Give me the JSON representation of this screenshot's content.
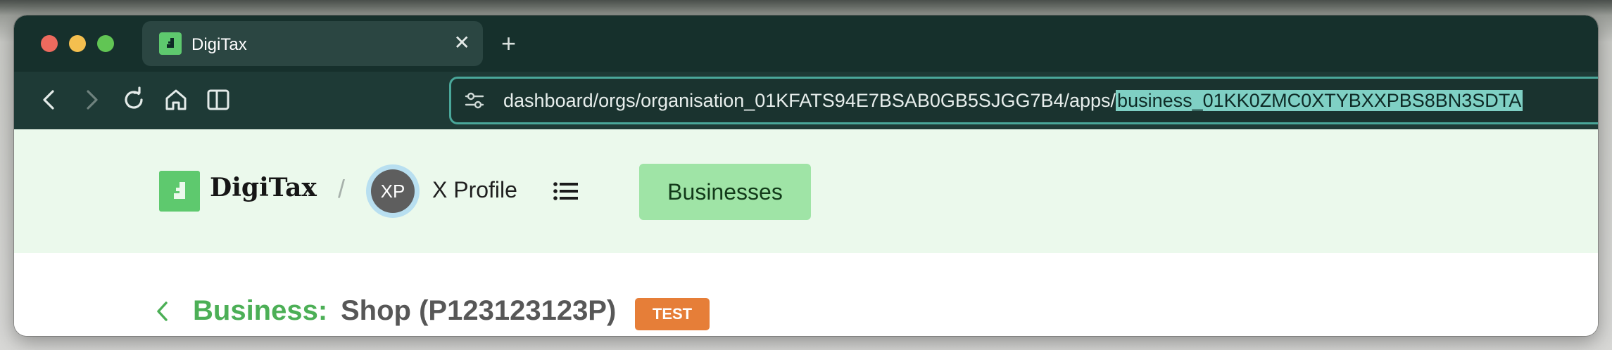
{
  "browser": {
    "tab": {
      "title": "DigiTax",
      "close_glyph": "✕"
    },
    "new_tab_glyph": "+",
    "toolbar_icons": [
      "back-arrow-icon",
      "forward-arrow-icon",
      "reload-icon",
      "home-icon",
      "sidebar-icon"
    ],
    "url": {
      "prefix": "dashboard/orgs/organisation_01KFATS94E7BSAB0GB5SJGG7B4/apps/",
      "selected": "business_01KK0ZMC0XTYBXXPBS8BN3SDTA"
    }
  },
  "header": {
    "logo_text": "DigiTax",
    "separator": "/",
    "avatar_initials": "XP",
    "profile_name": "X Profile",
    "businesses_button": "Businesses"
  },
  "page": {
    "business_label": "Business:",
    "business_name": "Shop (P123123123P)",
    "badge": "TEST"
  },
  "colors": {
    "brand_green": "#5ec96e",
    "header_bg": "#ebf9ec",
    "button_green": "#9fe4a6",
    "badge_orange": "#e67e38",
    "business_label_green": "#4caf56",
    "url_selection": "#7fd0c4"
  }
}
